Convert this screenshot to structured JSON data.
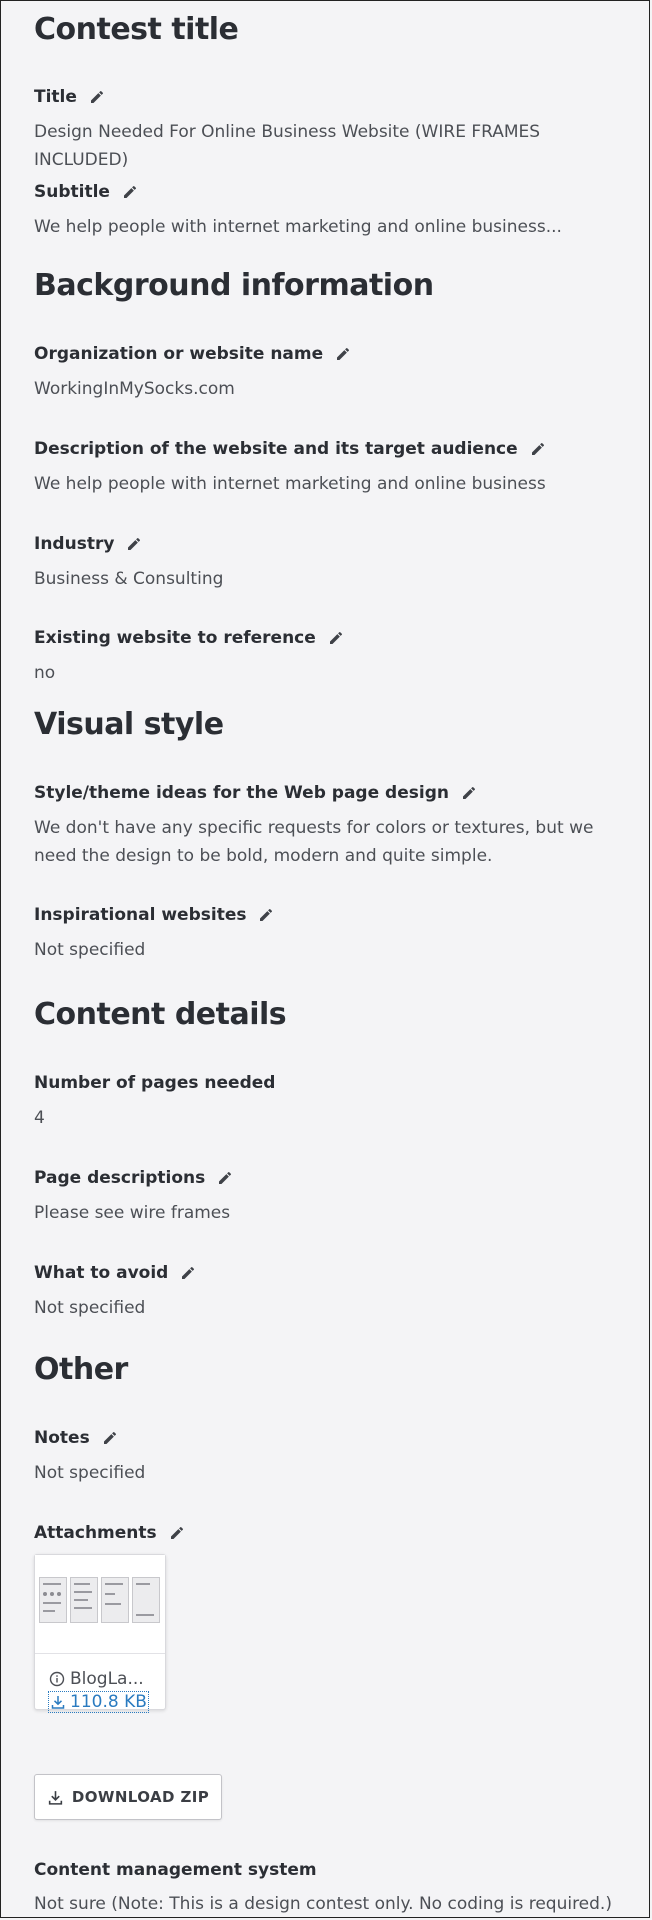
{
  "sections": {
    "contest_title": "Contest title",
    "background": "Background information",
    "visual_style": "Visual style",
    "content_details": "Content details",
    "other": "Other"
  },
  "fields": {
    "title": {
      "label": "Title",
      "value": "Design Needed For Online Business Website (WIRE FRAMES INCLUDED)"
    },
    "subtitle": {
      "label": "Subtitle",
      "value": "We help people with internet marketing and online business..."
    },
    "org_name": {
      "label": "Organization or website name",
      "value": "WorkingInMySocks.com"
    },
    "description": {
      "label": "Description of the website and its target audience",
      "value": "We help people with internet marketing and online business"
    },
    "industry": {
      "label": "Industry",
      "value": "Business & Consulting"
    },
    "existing_site": {
      "label": "Existing website to reference",
      "value": "no"
    },
    "style_ideas": {
      "label": "Style/theme ideas for the Web page design",
      "value": "We don't have any specific requests for colors or textures, but we need the design to be bold, modern and quite simple."
    },
    "inspirational": {
      "label": "Inspirational websites",
      "value": "Not specified"
    },
    "num_pages": {
      "label": "Number of pages needed",
      "value": "4"
    },
    "page_descriptions": {
      "label": "Page descriptions",
      "value": "Please see wire frames"
    },
    "avoid": {
      "label": "What to avoid",
      "value": "Not specified"
    },
    "notes": {
      "label": "Notes",
      "value": "Not specified"
    },
    "attachments": {
      "label": "Attachments"
    },
    "cms": {
      "label": "Content management system",
      "value": "Not sure (Note: This is a design contest only. No coding is required.)"
    }
  },
  "attachment": {
    "name": "BlogLa...",
    "size": "110.8 KB"
  },
  "download_zip_label": "DOWNLOAD ZIP",
  "icons": {
    "edit": "pencil-icon",
    "info": "info-icon",
    "download": "download-icon"
  },
  "colors": {
    "link": "#2a7bc0",
    "heading": "#2b2e34",
    "value": "#4c4f55",
    "background": "#f4f4f6"
  }
}
